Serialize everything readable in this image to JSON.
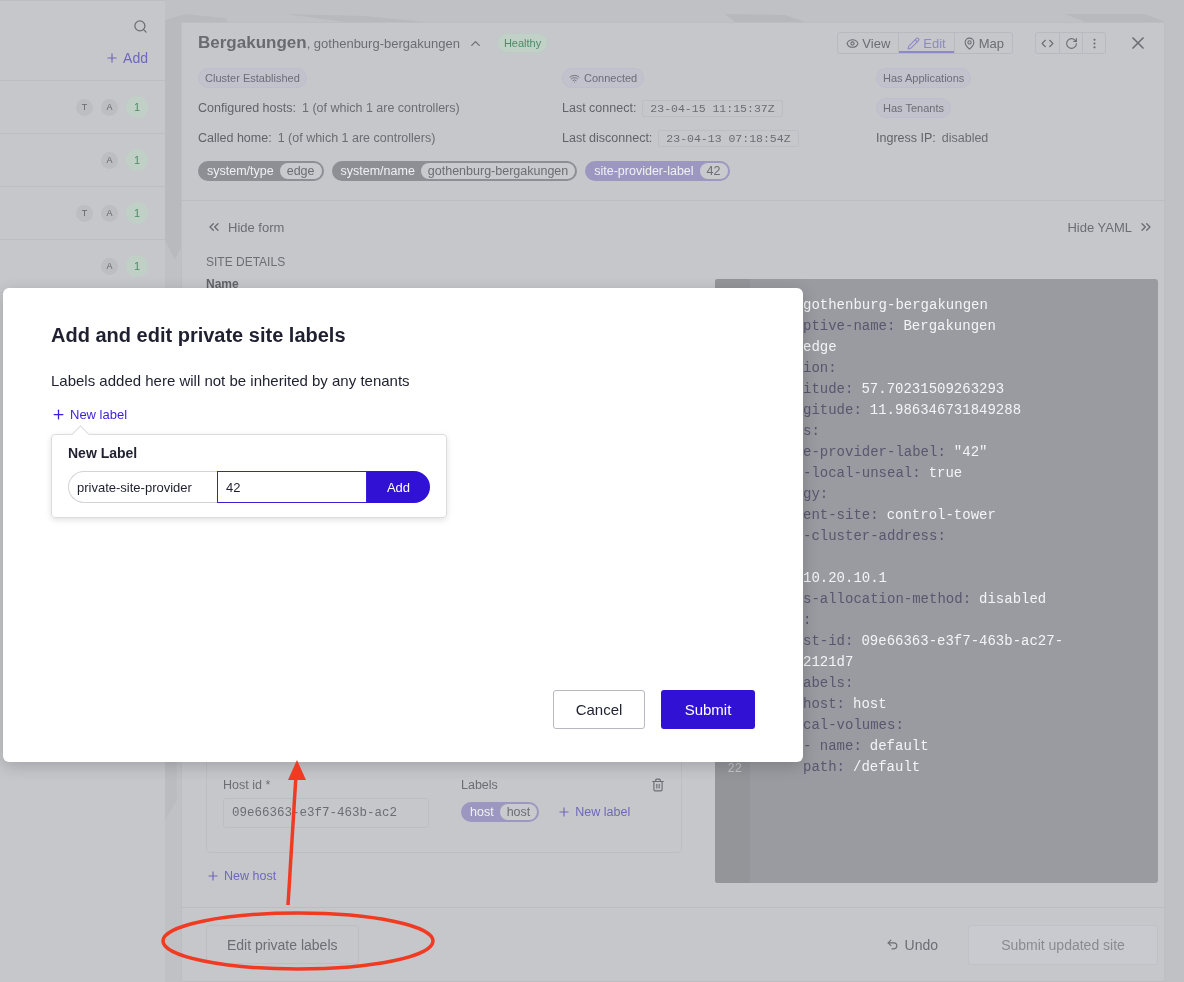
{
  "sidebar": {
    "add": "Add",
    "rows": [
      {
        "badges": [
          "T",
          "A"
        ],
        "count": "1"
      },
      {
        "badges": [
          "A"
        ],
        "count": "1"
      },
      {
        "badges": [
          "T",
          "A"
        ],
        "count": "1"
      },
      {
        "badges": [
          "A"
        ],
        "count": "1"
      }
    ]
  },
  "site": {
    "title": "Bergakungen",
    "subtitle": ", gothenburg-bergakungen",
    "expanded": true,
    "status": "Healthy",
    "view_tabs": [
      {
        "label": "View",
        "selected": false
      },
      {
        "label": "Edit",
        "selected": true
      },
      {
        "label": "Map",
        "selected": false
      }
    ],
    "columns": [
      {
        "items": [
          {
            "kind": "badge",
            "text": "Cluster Established"
          },
          {
            "kind": "field",
            "label": "Configured hosts:",
            "value": "1 (of which 1 are controllers)"
          },
          {
            "kind": "field",
            "label": "Called home:",
            "value": "1 (of which 1 are controllers)"
          }
        ]
      },
      {
        "items": [
          {
            "kind": "signal",
            "text": "Connected"
          },
          {
            "kind": "timestamp",
            "label": "Last connect:",
            "value": "23-04-15 11:15:37Z"
          },
          {
            "kind": "timestamp",
            "label": "Last disconnect:",
            "value": "23-04-13 07:18:54Z"
          }
        ]
      },
      {
        "items": [
          {
            "kind": "badge",
            "text": "Has Applications"
          },
          {
            "kind": "badge",
            "text": "Has Tenants"
          },
          {
            "kind": "field",
            "label": "Ingress IP:",
            "value": "disabled"
          }
        ]
      }
    ],
    "labels": [
      {
        "key": "system/type",
        "value": "edge",
        "color": "#8e8f94"
      },
      {
        "key": "system/name",
        "value": "gothenburg-bergakungen",
        "color": "#8e8f94"
      },
      {
        "key": "site-provider-label",
        "value": "42",
        "color": "#9c97c0"
      }
    ]
  },
  "form": {
    "hide_form": "Hide form",
    "hide_yaml": "Hide YAML",
    "section": "SITE DETAILS",
    "name_label": "Name",
    "host": {
      "id_label": "Host id",
      "required": "*",
      "id_value": "09e66363-e3f7-463b-ac2",
      "labels_label": "Labels",
      "labels": [
        {
          "key": "host",
          "value": "host"
        }
      ],
      "new_label": "New label"
    },
    "new_host": "New host"
  },
  "yaml": [
    {
      "value": "gothenburg-bergakungen"
    },
    {
      "key": "ptive-name:",
      "value": "Bergakungen"
    },
    {
      "value": "edge"
    },
    {
      "key": "ion:"
    },
    {
      "key": "itude:",
      "value": "57.70231509263293"
    },
    {
      "key": "gitude:",
      "value": "11.986346731849288"
    },
    {
      "key": "s:"
    },
    {
      "key": "e-provider-label:",
      "value": "\"42\""
    },
    {
      "key": "-local-unseal:",
      "value": "true"
    },
    {
      "key": "gy:"
    },
    {
      "key": "ent-site:",
      "value": "control-tower"
    },
    {
      "key": "-cluster-address:"
    },
    {
      "value": "10.20.10.1",
      "gap_before": true
    },
    {
      "key": "s-allocation-method:",
      "value": "disabled"
    },
    {
      "key": ":"
    },
    {
      "key": "st-id:",
      "value": "09e66363-e3f7-463b-ac27-"
    },
    {
      "value": "2121d7"
    },
    {
      "key": "abels:"
    },
    {
      "key": "host:",
      "value": "host"
    },
    {
      "key": "cal-volumes:"
    },
    {
      "key": "- name:",
      "value": "default"
    },
    {
      "number": "22",
      "key": "path:",
      "value": "/default"
    }
  ],
  "footer": {
    "edit_private_labels": "Edit private labels",
    "undo": "Undo",
    "submit": "Submit updated site"
  },
  "modal": {
    "title": "Add and edit private site labels",
    "description": "Labels added here will not be inherited by any tenants",
    "new_label": "New label",
    "popover": {
      "title": "New Label",
      "key_value": "private-site-provider",
      "value_value": "42",
      "add": "Add"
    },
    "cancel": "Cancel",
    "submit": "Submit"
  }
}
